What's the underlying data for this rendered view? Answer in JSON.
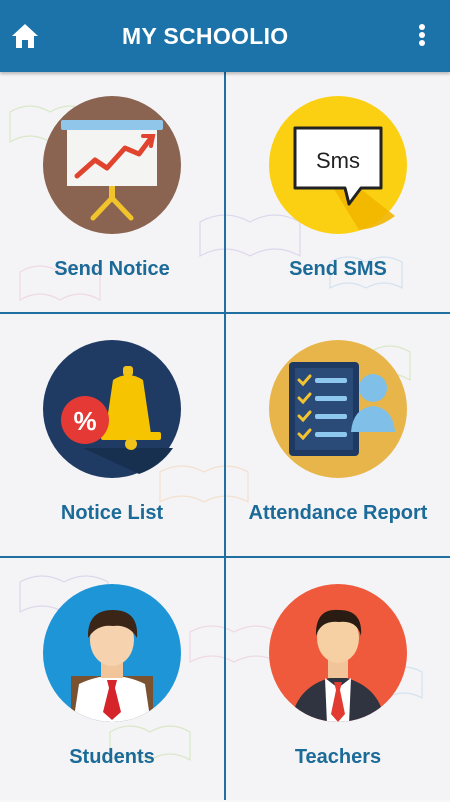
{
  "app_bar": {
    "title": "MY SCHOOLIO",
    "home_icon": "home-icon",
    "menu_icon": "more-vert-icon"
  },
  "colors": {
    "app_bar": "#1b73a9",
    "label": "#1b6a98",
    "divider": "#1f6fa0"
  },
  "menu": [
    {
      "label": "Send Notice",
      "icon": "presentation-chart-icon"
    },
    {
      "label": "Send SMS",
      "icon": "sms-bubble-icon"
    },
    {
      "label": "Notice List",
      "icon": "bell-percent-icon"
    },
    {
      "label": "Attendance Report",
      "icon": "attendance-checklist-icon"
    },
    {
      "label": "Students",
      "icon": "student-icon"
    },
    {
      "label": "Teachers",
      "icon": "teacher-icon"
    }
  ]
}
